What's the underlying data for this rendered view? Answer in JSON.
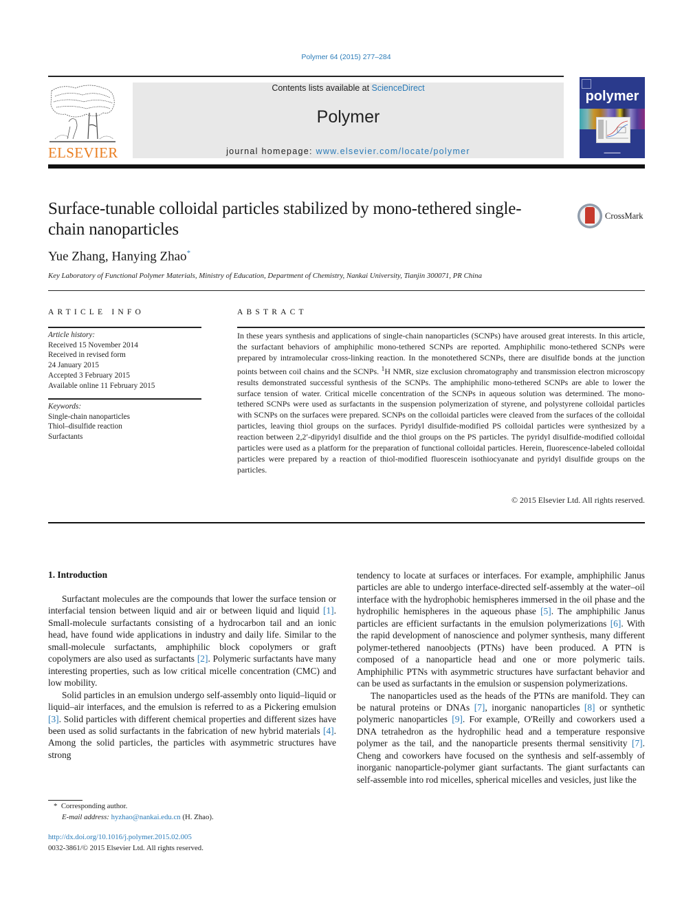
{
  "header": {
    "citation": "Polymer 64 (2015) 277–284",
    "publisher_logo_text": "ELSEVIER",
    "contents_prefix": "Contents lists available at ",
    "contents_link": "ScienceDirect",
    "journal_name": "Polymer",
    "homepage_prefix": "journal homepage: ",
    "homepage_link": "www.elsevier.com/locate/polymer",
    "cover_title": "polymer",
    "crossmark_label": "CrossMark"
  },
  "article": {
    "title": "Surface-tunable colloidal particles stabilized by mono-tethered single-chain nanoparticles",
    "authors": "Yue Zhang, Hanying Zhao",
    "corresponding_marker": "*",
    "affiliation": "Key Laboratory of Functional Polymer Materials, Ministry of Education, Department of Chemistry, Nankai University, Tianjin 300071, PR China"
  },
  "article_info": {
    "heading": "ARTICLE INFO",
    "history_label": "Article history:",
    "history": [
      "Received 15 November 2014",
      "Received in revised form",
      "24 January 2015",
      "Accepted 3 February 2015",
      "Available online 11 February 2015"
    ],
    "keywords_label": "Keywords:",
    "keywords": [
      "Single-chain nanoparticles",
      "Thiol–disulfide reaction",
      "Surfactants"
    ]
  },
  "abstract": {
    "heading": "ABSTRACT",
    "text_part1": "In these years synthesis and applications of single-chain nanoparticles (SCNPs) have aroused great in­terests. In this article, the surfactant behaviors of amphiphilic mono-tethered SCNPs are reported. Amphiphilic mono-tethered SCNPs were prepared by intramolecular cross-linking reaction. In the mono­tethered SCNPs, there are disulfide bonds at the junction points between coil chains and the SCNPs. ",
    "superscript": "1",
    "text_part2": "H NMR, size exclusion chromatography and transmission electron microscopy results demonstrated suc­cessful synthesis of the SCNPs. The amphiphilic mono-tethered SCNPs are able to lower the surface tension of water. Critical micelle concentration of the SCNPs in aqueous solution was determined. The mono-tethered SCNPs were used as surfactants in the suspension polymerization of styrene, and poly­styrene colloidal particles with SCNPs on the surfaces were prepared. SCNPs on the colloidal particles were cleaved from the surfaces of the colloidal particles, leaving thiol groups on the surfaces. Pyridyl disulfide-modified PS colloidal particles were synthesized by a reaction between 2,2′-dipyridyl disulfide and the thiol groups on the PS particles. The pyridyl disulfide-modified colloidal particles were used as a platform for the preparation of functional colloidal particles. Herein, fluorescence-labeled colloidal particles were prepared by a reaction of thiol-modified fluorescein isothiocyanate and pyridyl disulfide groups on the particles.",
    "copyright": "© 2015 Elsevier Ltd. All rights reserved."
  },
  "body": {
    "section_title": "1.  Introduction",
    "p1": [
      {
        "t": "Surfactant molecules are the compounds that lower the surface tension or interfacial tension between liquid and air or between liquid and liquid "
      },
      {
        "ref": "[1]"
      },
      {
        "t": ". Small-molecule surfactants consisting of a hydrocarbon tail and an ionic head, have found wide applications in industry and daily life. Similar to the small-molecule surfactants, amphiphilic block copolymers or graft copolymers are also used as surfactants "
      },
      {
        "ref": "[2]"
      },
      {
        "t": ". Polymeric surfactants have many interesting properties, such as low critical micelle concentration (CMC) and low mobility."
      }
    ],
    "p2": [
      {
        "t": "Solid particles in an emulsion undergo self-assembly onto liq­uid–liquid or liquid–air interfaces, and the emulsion is referred to as a Pickering emulsion "
      },
      {
        "ref": "[3]"
      },
      {
        "t": ". Solid particles with different chemical properties and different sizes have been used as solid surfactants in the fabrication of new hybrid materials "
      },
      {
        "ref": "[4]"
      },
      {
        "t": ". Among the solid par­ticles, the particles with asymmetric structures have strong"
      }
    ],
    "p3": [
      {
        "t": "tendency to locate at surfaces or interfaces. For example, amphi­philic Janus particles are able to undergo interface-directed self-assembly at the water–oil interface with the hydrophobic hemi­spheres immersed in the oil phase and the hydrophilic hemi­spheres in the aqueous phase "
      },
      {
        "ref": "[5]"
      },
      {
        "t": ". The amphiphilic Janus particles are efficient surfactants in the emulsion polymerizations "
      },
      {
        "ref": "[6]"
      },
      {
        "t": ". With the rapid development of nanoscience and polymer synthesis, many different polymer-tethered nanoobjects (PTNs) have been produced. A PTN is composed of a nanoparticle head and one or more polymeric tails. Amphiphilic PTNs with asymmetric struc­tures have surfactant behavior and can be used as surfactants in the emulsion or suspension polymerizations."
      }
    ],
    "p4": [
      {
        "t": "The nanoparticles used as the heads of the PTNs are manifold. They can be natural proteins or DNAs "
      },
      {
        "ref": "[7]"
      },
      {
        "t": ", inorganic nanoparticles "
      },
      {
        "ref": "[8]"
      },
      {
        "t": " or synthetic polymeric nanoparticles "
      },
      {
        "ref": "[9]"
      },
      {
        "t": ". For example, O'Reilly and coworkers used a DNA tetrahedron as the hydrophilic head and a temperature responsive polymer as the tail, and the nanoparticle presents thermal sensitivity "
      },
      {
        "ref": "[7]"
      },
      {
        "t": ". Cheng and coworkers have focused on the synthesis and self-assembly of inorganic nanoparticle-polymer giant surfactants. The giant surfactants can self-assemble into rod micelles, spherical micelles and vesicles, just like the"
      }
    ]
  },
  "footnotes": {
    "marker": "*",
    "corresponding": "Corresponding author.",
    "email_label": "E-mail address: ",
    "email": "hyzhao@nankai.edu.cn",
    "email_suffix": " (H. Zhao).",
    "doi": "http://dx.doi.org/10.1016/j.polymer.2015.02.005",
    "issn_copyright": "0032-3861/© 2015 Elsevier Ltd. All rights reserved."
  },
  "colors": {
    "link": "#2a7bb8",
    "elsevier_orange": "#e97d1f",
    "cover_blue": "#2a3a8c",
    "header_box_gray": "#e8e8e8"
  }
}
